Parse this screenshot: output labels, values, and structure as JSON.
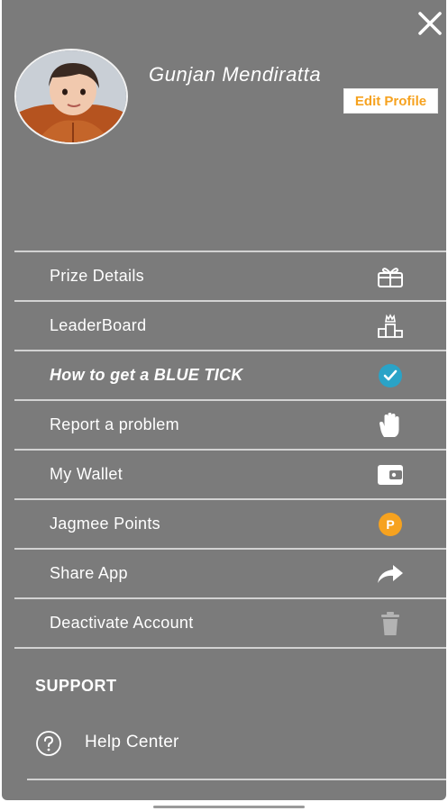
{
  "profile": {
    "name": "Gunjan Mendiratta",
    "edit_label": "Edit Profile"
  },
  "menu": {
    "items": [
      {
        "label": "Prize Details",
        "icon": "gift-box-icon"
      },
      {
        "label": "LeaderBoard",
        "icon": "leaderboard-podium-icon"
      },
      {
        "label": "How to get a BLUE TICK",
        "icon": "blue-tick-icon"
      },
      {
        "label": "Report a problem",
        "icon": "raised-hand-icon"
      },
      {
        "label": "My Wallet",
        "icon": "wallet-icon"
      },
      {
        "label": "Jagmee Points",
        "icon": "points-coin-icon"
      },
      {
        "label": "Share App",
        "icon": "share-arrow-icon"
      },
      {
        "label": "Deactivate Account",
        "icon": "trash-icon"
      }
    ]
  },
  "support": {
    "title": "SUPPORT",
    "help_label": "Help Center",
    "help_icon": "question-circle-icon"
  },
  "points_badge": "P",
  "colors": {
    "drawer_bg": "#7b7b7b",
    "accent_orange": "#f6a21f",
    "tick_blue": "#2aa3c7",
    "separator": "#d2d2d2"
  }
}
